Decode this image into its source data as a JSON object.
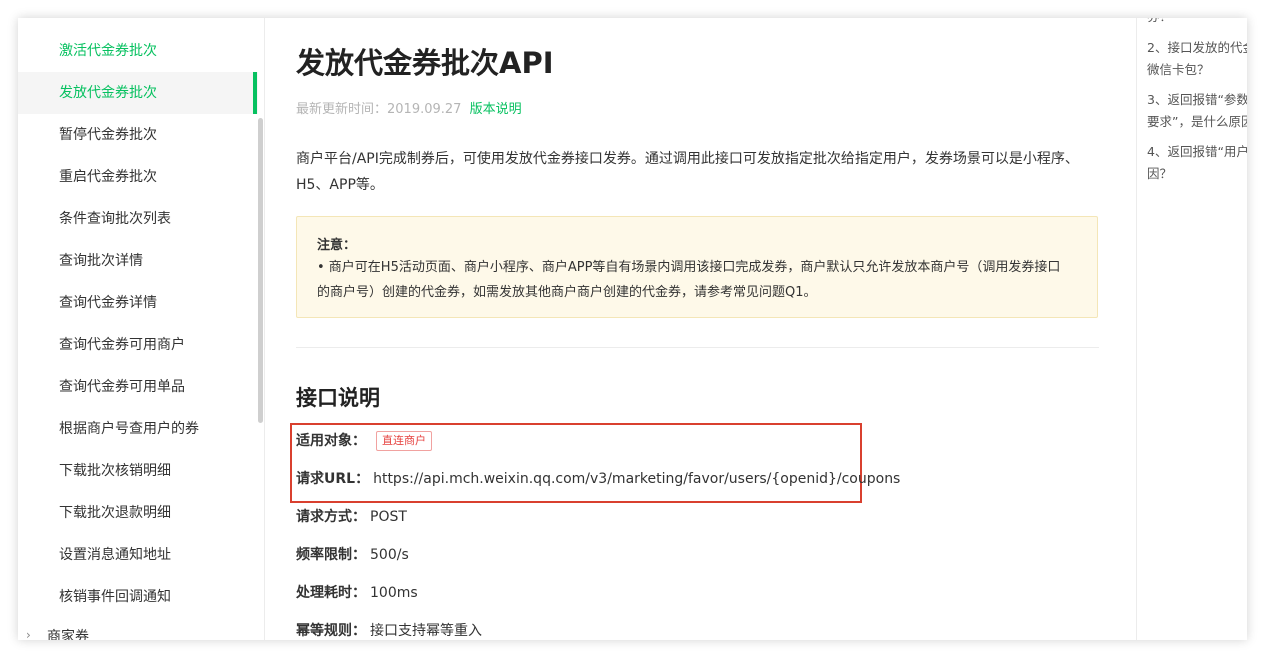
{
  "sidebar": {
    "items": [
      {
        "label": "激活代金券批次"
      },
      {
        "label": "发放代金券批次"
      },
      {
        "label": "暂停代金券批次"
      },
      {
        "label": "重启代金券批次"
      },
      {
        "label": "条件查询批次列表"
      },
      {
        "label": "查询批次详情"
      },
      {
        "label": "查询代金券详情"
      },
      {
        "label": "查询代金券可用商户"
      },
      {
        "label": "查询代金券可用单品"
      },
      {
        "label": "根据商户号查用户的券"
      },
      {
        "label": "下载批次核销明细"
      },
      {
        "label": "下载批次退款明细"
      },
      {
        "label": "设置消息通知地址"
      },
      {
        "label": "核销事件回调通知"
      }
    ],
    "group_label": "商家券",
    "active_index": 1
  },
  "main": {
    "title": "发放代金券批次API",
    "updated_label": "最新更新时间：2019.09.27",
    "version_link": "版本说明",
    "description": "商户平台/API完成制券后，可使用发放代金券接口发券。通过调用此接口可发放指定批次给指定用户，发券场景可以是小程序、H5、APP等。",
    "notice": {
      "title": "注意：",
      "text": "• 商户可在H5活动页面、商户小程序、商户APP等自有场景内调用该接口完成发券，商户默认只允许发放本商户号（调用发券接口的商户号）创建的代金券，如需发放其他商户商户创建的代金券，请参考常见问题Q1。"
    },
    "section_title": "接口说明",
    "fields": {
      "target": {
        "key": "适用对象：",
        "badge": "直连商户"
      },
      "url": {
        "key": "请求URL：",
        "value": "https://api.mch.weixin.qq.com/v3/marketing/favor/users/{openid}/coupons"
      },
      "method": {
        "key": "请求方式：",
        "value": "POST"
      },
      "rate": {
        "key": "频率限制：",
        "value": "500/s"
      },
      "time": {
        "key": "处理耗时：",
        "value": "100ms"
      },
      "idempotent": {
        "key": "幂等规则：",
        "value": "接口支持幂等重入"
      }
    }
  },
  "faq": {
    "items": [
      {
        "lines": [
          "券？"
        ]
      },
      {
        "lines": [
          "2、接口发放的代金",
          "微信卡包？"
        ]
      },
      {
        "lines": [
          "3、返回报错“参数",
          "要求”，是什么原因"
        ]
      },
      {
        "lines": [
          "4、返回报错“用户",
          "因？"
        ]
      }
    ]
  },
  "colors": {
    "accent": "#07c160",
    "highlight_border": "#d9402f",
    "badge": "#e64340",
    "notice_bg": "#fef9e9"
  }
}
